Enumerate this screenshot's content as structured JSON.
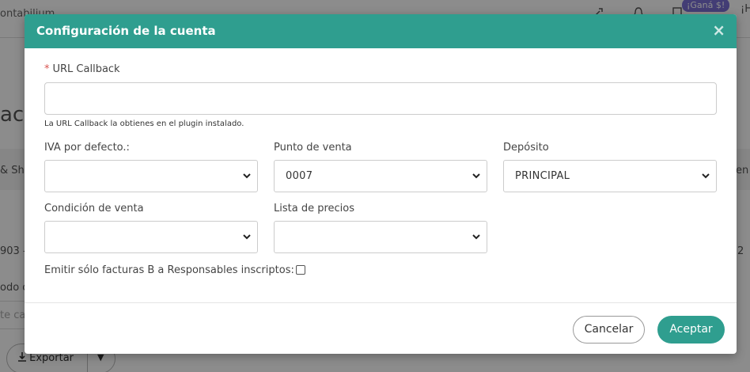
{
  "background": {
    "brand": "ontabilium",
    "gana_badge": "¡Ganá $!",
    "edge_right": "¡H",
    "page_title": "aci",
    "table_col": "& Sho",
    "table_col_right": "en",
    "row_value": "903 -",
    "row_value_right": "2",
    "filter_label": "odo c",
    "search_placeholder": "te ca",
    "export_label": "Exportar"
  },
  "modal": {
    "title": "Configuración de la cuenta",
    "close_glyph": "×",
    "url_callback": {
      "required_mark": "*",
      "label": "URL Callback",
      "value": "",
      "help": "La URL Callback la obtienes en el plugin instalado."
    },
    "iva": {
      "label": "IVA por defecto.:",
      "value": ""
    },
    "punto_venta": {
      "label": "Punto de venta",
      "value": "0007"
    },
    "deposito": {
      "label": "Depósito",
      "value": "PRINCIPAL"
    },
    "condicion_venta": {
      "label": "Condición de venta",
      "value": ""
    },
    "lista_precios": {
      "label": "Lista de precios",
      "value": ""
    },
    "emitir_label": "Emitir sólo facturas B a Responsables inscriptos:",
    "emitir_checked": false,
    "cancel_label": "Cancelar",
    "accept_label": "Aceptar"
  },
  "colors": {
    "header": "#2f9e8f",
    "accept": "#2f9e8f",
    "required": "#d9534f",
    "badge": "#7b6fd6"
  }
}
